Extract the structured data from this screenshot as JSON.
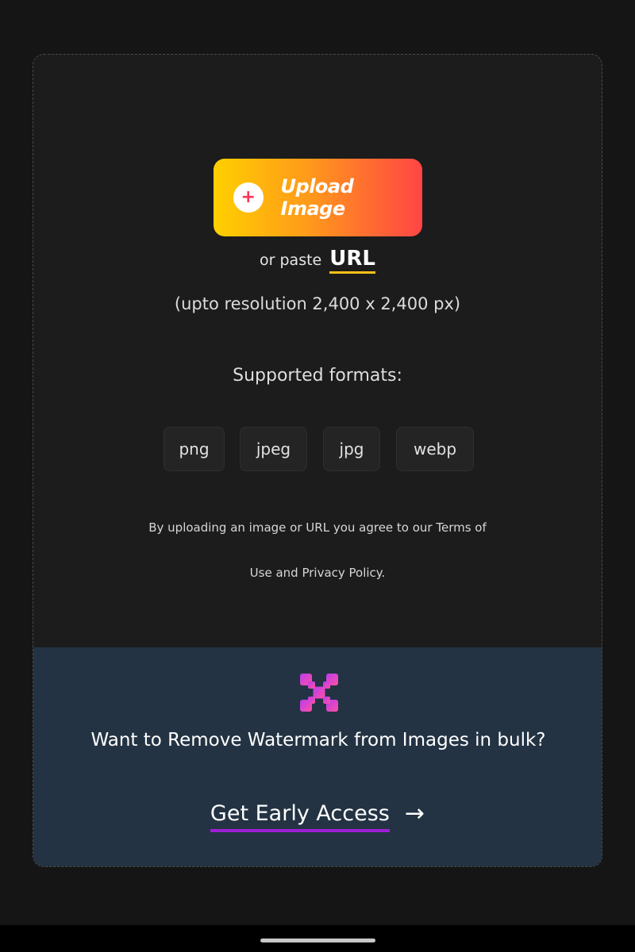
{
  "upload": {
    "button_label": "Upload Image",
    "plus_symbol": "+",
    "paste_prefix": "or paste",
    "url_label": "URL",
    "resolution_note": "(upto resolution 2,400 x 2,400 px)",
    "formats_title": "Supported formats:",
    "formats": [
      "png",
      "jpeg",
      "jpg",
      "webp"
    ],
    "terms_line1": "By uploading an image or URL you agree to our Terms of",
    "terms_line2": "Use and Privacy Policy."
  },
  "bulk": {
    "logo_icon": "checker-x-logo-icon",
    "title": "Want to Remove Watermark from Images in bulk?",
    "cta_label": "Get Early Access",
    "cta_arrow": "→"
  },
  "colors": {
    "upload_gradient": [
      "#ffd000",
      "#ff9a1a",
      "#ff4545"
    ],
    "url_underline": "#ffc21a",
    "cta_underline": "#9d1fd6",
    "bulk_background": "#233343",
    "logo_gradient": [
      "#b93df0",
      "#ff4fa3"
    ]
  }
}
